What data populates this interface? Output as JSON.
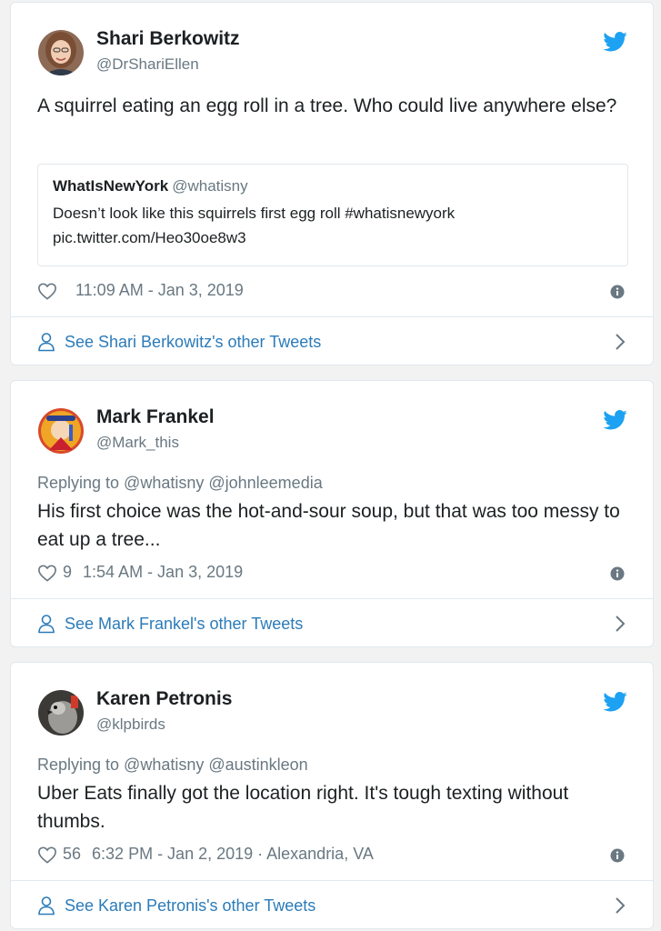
{
  "tweets": [
    {
      "name": "Shari Berkowitz",
      "handle": "@DrShariEllen",
      "text": "A squirrel eating an egg roll in a tree.  Who could live anywhere else?",
      "quote": {
        "name": "WhatIsNewYork",
        "handle": "@whatisny",
        "text_line1": "Doesn’t look like this squirrels first egg roll #whatisnewyork",
        "text_line2": "pic.twitter.com/Heo30oe8w3"
      },
      "likes": "",
      "time": "11:09 AM - Jan 3, 2019",
      "footer": "See Shari Berkowitz's other Tweets"
    },
    {
      "name": "Mark Frankel",
      "handle": "@Mark_this",
      "reply": "Replying to @whatisny @johnleemedia",
      "text": "His first choice was the hot-and-sour soup, but that was too messy to eat up a tree...",
      "likes": "9",
      "time": "1:54 AM - Jan 3, 2019",
      "footer": "See Mark Frankel's other Tweets"
    },
    {
      "name": "Karen Petronis",
      "handle": "@klpbirds",
      "reply": "Replying to @whatisny @austinkleon",
      "text": "Uber Eats finally got the location right. It's tough texting without thumbs.",
      "likes": "56",
      "time": "6:32 PM - Jan 2, 2019 · Alexandria, VA",
      "footer": "See Karen Petronis's other Tweets"
    }
  ],
  "colors": {
    "twitter_blue": "#1da1f2",
    "link_blue": "#2b7bb9",
    "muted": "#697882",
    "text": "#1c2022",
    "border": "#e1e8ed"
  },
  "icons": [
    "twitter-bird-icon",
    "heart-icon",
    "info-icon",
    "person-icon",
    "chevron-right-icon"
  ]
}
